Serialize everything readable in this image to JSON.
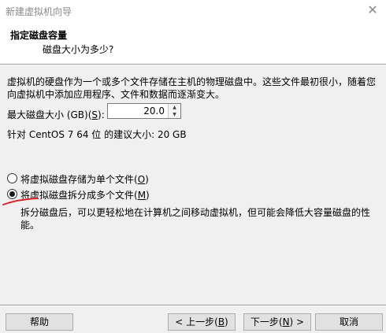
{
  "window": {
    "title": "新建虚拟机向导",
    "close_glyph": "✕"
  },
  "header": {
    "title": "指定磁盘容量",
    "subtitle": "磁盘大小为多少?"
  },
  "description": "虚拟机的硬盘作为一个或多个文件存储在主机的物理磁盘中。这些文件最初很小，随着您向虚拟机中添加应用程序、文件和数据而逐渐变大。",
  "disk_size": {
    "label_prefix": "最大磁盘大小 (GB)(",
    "label_accel": "S",
    "label_suffix": "):",
    "value": "20.0"
  },
  "recommendation": "针对 CentOS 7 64 位 的建议大小: 20 GB",
  "options": {
    "single": {
      "label_prefix": "将虚拟磁盘存储为单个文件(",
      "label_accel": "O",
      "label_suffix": ")",
      "checked": false
    },
    "split": {
      "label_prefix": "将虚拟磁盘拆分成多个文件(",
      "label_accel": "M",
      "label_suffix": ")",
      "checked": true,
      "description": "拆分磁盘后，可以更轻松地在计算机之间移动虚拟机，但可能会降低大容量磁盘的性能。"
    }
  },
  "buttons": {
    "help": "帮助",
    "back_prefix": "< 上一步(",
    "back_accel": "B",
    "back_suffix": ")",
    "next_prefix": "下一步(",
    "next_accel": "N",
    "next_suffix": ") >",
    "cancel": "取消"
  },
  "colors": {
    "annotation": "#d9232a"
  }
}
